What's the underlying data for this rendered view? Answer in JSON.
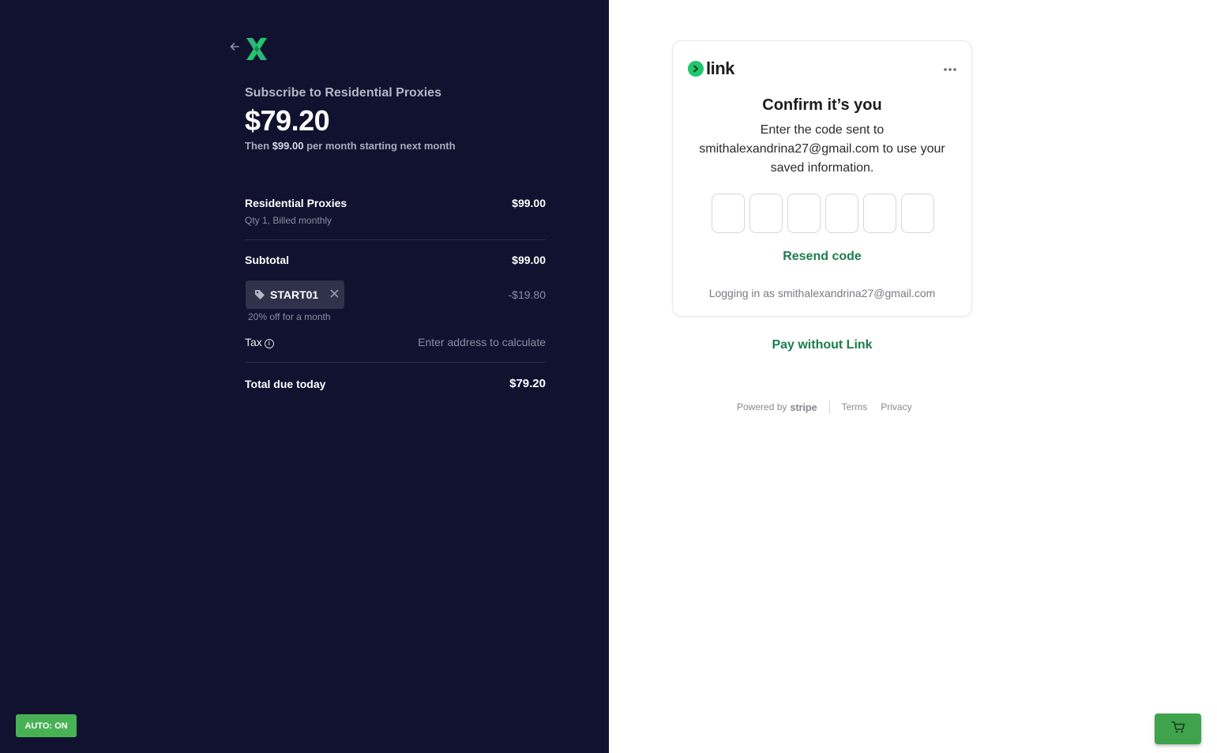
{
  "colors": {
    "left_bg": "#11122f",
    "brand_green": "#1ec76b",
    "link_green_text": "#1c7c50",
    "auto_button_bg": "#47b154",
    "cart_button_bg": "#3fa34d"
  },
  "summary": {
    "back_icon": "arrow-left-icon",
    "logo_icon": "x-logo-icon",
    "subscribe_title": "Subscribe to Residential Proxies",
    "price": "$79.20",
    "then_prefix": "Then",
    "then_amount": "$99.00",
    "then_suffix": "per month starting next month",
    "line_item": {
      "name": "Residential Proxies",
      "detail": "Qty 1, Billed monthly",
      "amount": "$99.00"
    },
    "subtotal_label": "Subtotal",
    "subtotal_value": "$99.00",
    "promo": {
      "icon": "tag-icon",
      "code": "START01",
      "remove_icon": "close-icon",
      "description": "20% off for a month",
      "amount": "-$19.80"
    },
    "tax_label": "Tax",
    "tax_info_icon": "info-icon",
    "tax_value": "Enter address to calculate",
    "total_label": "Total due today",
    "total_value": "$79.20"
  },
  "auto_button": {
    "label": "AUTO: ON"
  },
  "link_card": {
    "logo_text": "link",
    "menu_icon": "more-horizontal-icon",
    "title": "Confirm it’s you",
    "description": "Enter the code sent to smithalexandrina27@gmail.com to use your saved information.",
    "otp_count": 6,
    "resend_label": "Resend code",
    "logging_in_as": "Logging in as smithalexandrina27@gmail.com"
  },
  "pay_without_link": "Pay without Link",
  "footer": {
    "powered_by": "Powered by",
    "stripe": "stripe",
    "terms": "Terms",
    "privacy": "Privacy"
  },
  "cart_button": {
    "icon": "cart-icon"
  }
}
